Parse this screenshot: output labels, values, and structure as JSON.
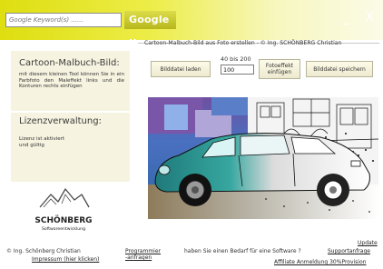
{
  "header": {
    "search_placeholder": "Google Keyword(s) ......",
    "google_button": "Google ..",
    "minimize_symbol": "_",
    "close_symbol": "X",
    "gradient_colors": [
      "#dede10",
      "#fbfbe8"
    ]
  },
  "sidebar": {
    "title": "Cartoon-Malbuch-Bild:",
    "description": "mit diesem kleinen Tool können Sie in ein Farbfoto den Maleffekt links und die Konturen rechts einfügen",
    "license_title": "Lizenzverwaltung:",
    "license_status": "Lizenz ist aktiviert und gültig"
  },
  "logo": {
    "name": "SCHÖNBERG",
    "tagline": "Softwareentwicklung"
  },
  "main": {
    "group_title": "Cartoon-Malbuch-Bild aus Foto erstellen - © Ing. SCHÖNBERG Christian",
    "load_button": "Bilddatei laden",
    "strength_hint": "40 bis 200",
    "strength_value": "100",
    "effect_button_line1": "Fotoeffekt",
    "effect_button_line2": "einfügen",
    "save_button": "Bilddatei speichern"
  },
  "footer": {
    "copyright": "© Ing. Schönberg Christian",
    "impressum": "Impressum (hier klicken)",
    "programmer_line1": "Programmier",
    "programmer_line2": "-anfragen",
    "question": "haben Sie einen Bedarf für eine Software ?",
    "support": "Supportanfrage",
    "update": "Update",
    "affiliate": "Affiliate Anmeldung 30%Provision"
  }
}
